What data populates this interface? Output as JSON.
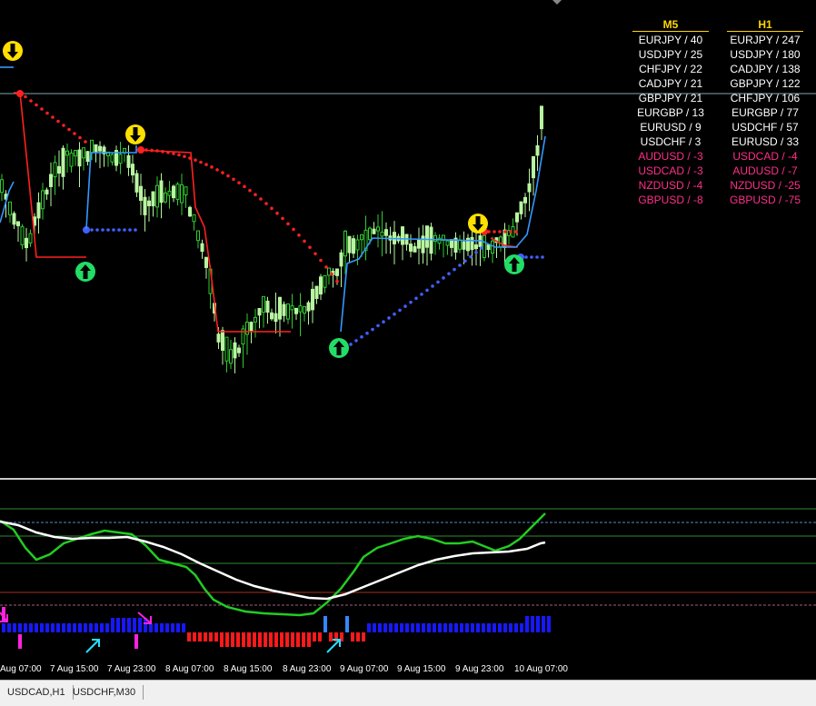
{
  "strength_table": {
    "m5_title": "M5",
    "h1_title": "H1",
    "m5": [
      "EURJPY / 40",
      "USDJPY / 25",
      "CHFJPY / 22",
      "CADJPY / 21",
      "GBPJPY / 21",
      "EURGBP / 13",
      "EURUSD / 9",
      "USDCHF / 3",
      "AUDUSD / -3",
      "USDCAD / -3",
      "NZDUSD / -4",
      "GBPUSD / -8"
    ],
    "h1": [
      "EURJPY / 247",
      "USDJPY / 180",
      "CADJPY / 138",
      "GBPJPY / 122",
      "CHFJPY / 106",
      "EURGBP / 77",
      "USDCHF / 57",
      "EURUSD / 33",
      "USDCAD / -4",
      "AUDUSD / -7",
      "NZDUSD / -25",
      "GBPUSD / -75"
    ],
    "positive_color": "#ffffff",
    "negative_color": "#ff2e8a"
  },
  "time_axis": [
    "Aug 07:00",
    "7 Aug 15:00",
    "7 Aug 23:00",
    "8 Aug 07:00",
    "8 Aug 15:00",
    "8 Aug 23:00",
    "9 Aug 07:00",
    "9 Aug 15:00",
    "9 Aug 23:00",
    "10 Aug 07:00"
  ],
  "tabs": [
    "USDCAD,H1",
    "USDCHF,M30"
  ],
  "colors": {
    "bull": "#b8f5a0",
    "bear": "#2ecc2e",
    "resistance": "#ff2020",
    "support": "#3399ff",
    "dots_support": "#4060ff",
    "signal_up": "#22dd66",
    "signal_down": "#ffe000",
    "osc_fast": "#22cc22",
    "osc_slow": "#ffffff",
    "hist_blue": "#1818ff",
    "hist_red": "#ff1a1a",
    "hist_magenta": "#ff22dd",
    "arrow_cyan": "#22e0ff"
  }
}
